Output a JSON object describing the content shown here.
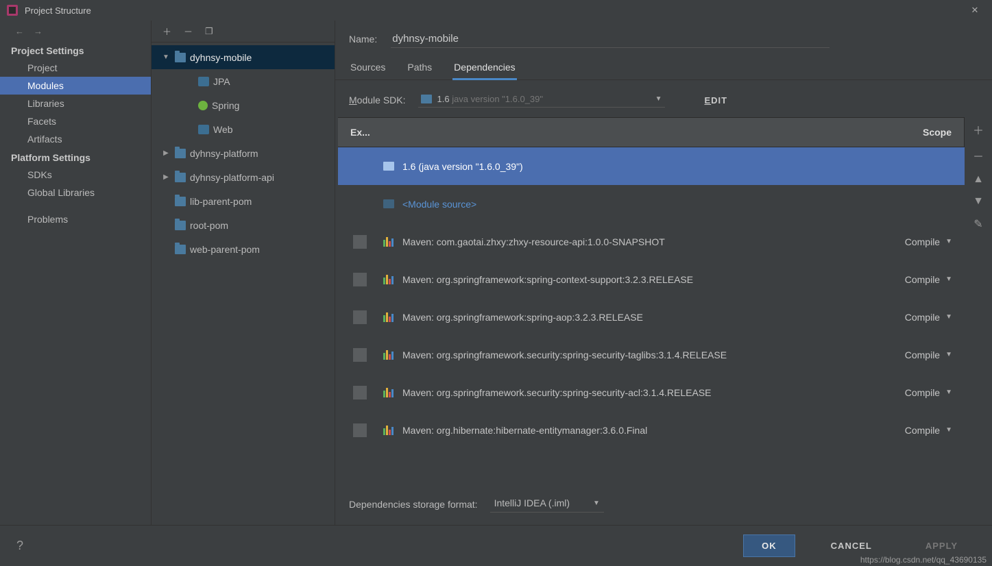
{
  "window": {
    "title": "Project Structure"
  },
  "sidebar": {
    "groups": [
      {
        "title": "Project Settings",
        "items": [
          {
            "label": "Project"
          },
          {
            "label": "Modules",
            "selected": true
          },
          {
            "label": "Libraries"
          },
          {
            "label": "Facets"
          },
          {
            "label": "Artifacts"
          }
        ]
      },
      {
        "title": "Platform Settings",
        "items": [
          {
            "label": "SDKs"
          },
          {
            "label": "Global Libraries"
          }
        ]
      }
    ],
    "problems_label": "Problems"
  },
  "tree": {
    "nodes": [
      {
        "label": "dyhnsy-mobile",
        "icon": "folder",
        "expanded": true,
        "selected": true,
        "depth": 0,
        "children": [
          {
            "label": "JPA",
            "icon": "jpa",
            "depth": 1
          },
          {
            "label": "Spring",
            "icon": "spring",
            "depth": 1
          },
          {
            "label": "Web",
            "icon": "web",
            "depth": 1
          }
        ]
      },
      {
        "label": "dyhnsy-platform",
        "icon": "folder",
        "expanded": false,
        "depth": 0
      },
      {
        "label": "dyhnsy-platform-api",
        "icon": "folder",
        "expanded": false,
        "depth": 0
      },
      {
        "label": "lib-parent-pom",
        "icon": "folder",
        "leaf": true,
        "depth": 0
      },
      {
        "label": "root-pom",
        "icon": "folder",
        "leaf": true,
        "depth": 0
      },
      {
        "label": "web-parent-pom",
        "icon": "folder",
        "leaf": true,
        "depth": 0
      }
    ]
  },
  "detail": {
    "name_label": "Name:",
    "name_value": "dyhnsy-mobile",
    "tabs": [
      {
        "label": "Sources"
      },
      {
        "label": "Paths"
      },
      {
        "label": "Dependencies",
        "active": true
      }
    ],
    "sdk": {
      "label_before": "M",
      "label_after": "odule SDK:",
      "value_prefix": "1.6 ",
      "value_suffix": "java version \"1.6.0_39\"",
      "edit_u": "E",
      "edit_rest": "DIT"
    },
    "table": {
      "col_name": "Ex...",
      "col_scope": "Scope",
      "rows": [
        {
          "kind": "sdk",
          "label": "1.6 (java version \"1.6.0_39\")",
          "selected": true
        },
        {
          "kind": "module",
          "label": "<Module source>"
        },
        {
          "kind": "lib",
          "label": "Maven: com.gaotai.zhxy:zhxy-resource-api:1.0.0-SNAPSHOT",
          "scope": "Compile"
        },
        {
          "kind": "lib",
          "label": "Maven: org.springframework:spring-context-support:3.2.3.RELEASE",
          "scope": "Compile"
        },
        {
          "kind": "lib",
          "label": "Maven: org.springframework:spring-aop:3.2.3.RELEASE",
          "scope": "Compile"
        },
        {
          "kind": "lib",
          "label": "Maven: org.springframework.security:spring-security-taglibs:3.1.4.RELEASE",
          "scope": "Compile"
        },
        {
          "kind": "lib",
          "label": "Maven: org.springframework.security:spring-security-acl:3.1.4.RELEASE",
          "scope": "Compile"
        },
        {
          "kind": "lib",
          "label": "Maven: org.hibernate:hibernate-entitymanager:3.6.0.Final",
          "scope": "Compile"
        }
      ]
    },
    "storage": {
      "label": "Dependencies storage format:",
      "value": "IntelliJ IDEA (.iml)"
    }
  },
  "footer": {
    "ok": "OK",
    "cancel": "CANCEL",
    "apply": "APPLY",
    "watermark": "https://blog.csdn.net/qq_43690135"
  }
}
